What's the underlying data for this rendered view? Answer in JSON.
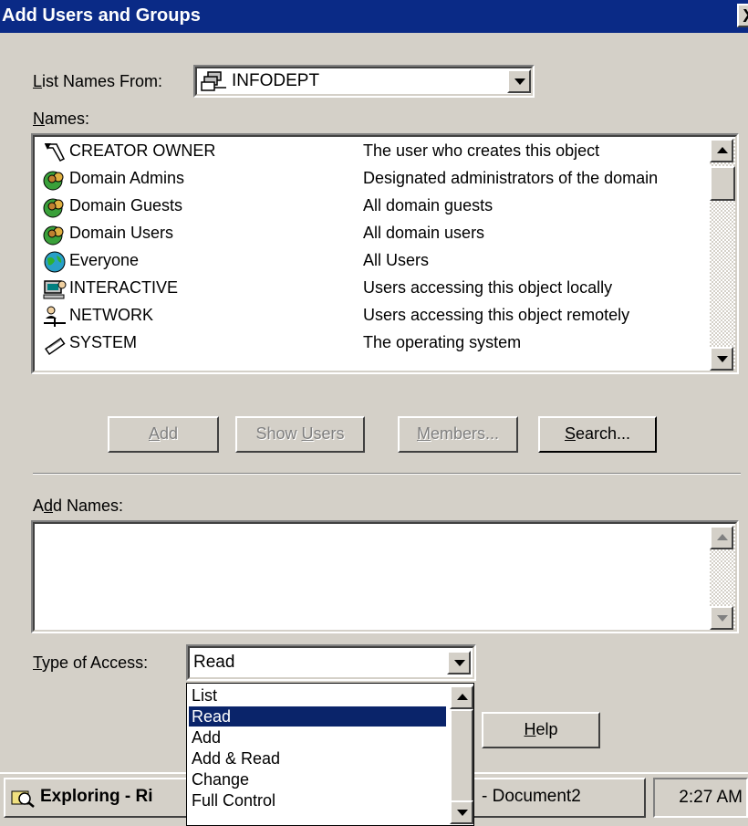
{
  "window": {
    "title": "Add Users and Groups",
    "close_glyph": "X"
  },
  "list_names_from": {
    "label": "List Names From:",
    "value": "INFODEPT",
    "icon": "domain-computers-icon"
  },
  "names": {
    "label": "Names:",
    "items": [
      {
        "name": "CREATOR OWNER",
        "description": "The user who creates this object",
        "icon": "creator-owner-icon"
      },
      {
        "name": "Domain Admins",
        "description": "Designated administrators of the domain",
        "icon": "global-group-icon"
      },
      {
        "name": "Domain Guests",
        "description": "All domain guests",
        "icon": "global-group-icon"
      },
      {
        "name": "Domain Users",
        "description": "All domain users",
        "icon": "global-group-icon"
      },
      {
        "name": "Everyone",
        "description": "All Users",
        "icon": "globe-icon"
      },
      {
        "name": "INTERACTIVE",
        "description": "Users accessing this object locally",
        "icon": "interactive-icon"
      },
      {
        "name": "NETWORK",
        "description": "Users accessing this object remotely",
        "icon": "network-icon"
      },
      {
        "name": "SYSTEM",
        "description": "The operating system",
        "icon": "system-icon"
      }
    ]
  },
  "buttons": {
    "add": "Add",
    "show_users": "Show Users",
    "members": "Members...",
    "search": "Search...",
    "help": "Help"
  },
  "add_names": {
    "label": "Add Names:",
    "value": ""
  },
  "type_of_access": {
    "label": "Type of Access:",
    "value": "Read",
    "options": [
      "List",
      "Read",
      "Add",
      "Add & Read",
      "Change",
      "Full Control"
    ],
    "selected_index": 1
  },
  "taskbar": {
    "item1": "Exploring - Ri",
    "item2": "- Document2",
    "clock": "2:27 AM"
  },
  "colors": {
    "titlebar": "#0a2a86",
    "face": "#d4d0c8",
    "selection": "#0a246a"
  }
}
